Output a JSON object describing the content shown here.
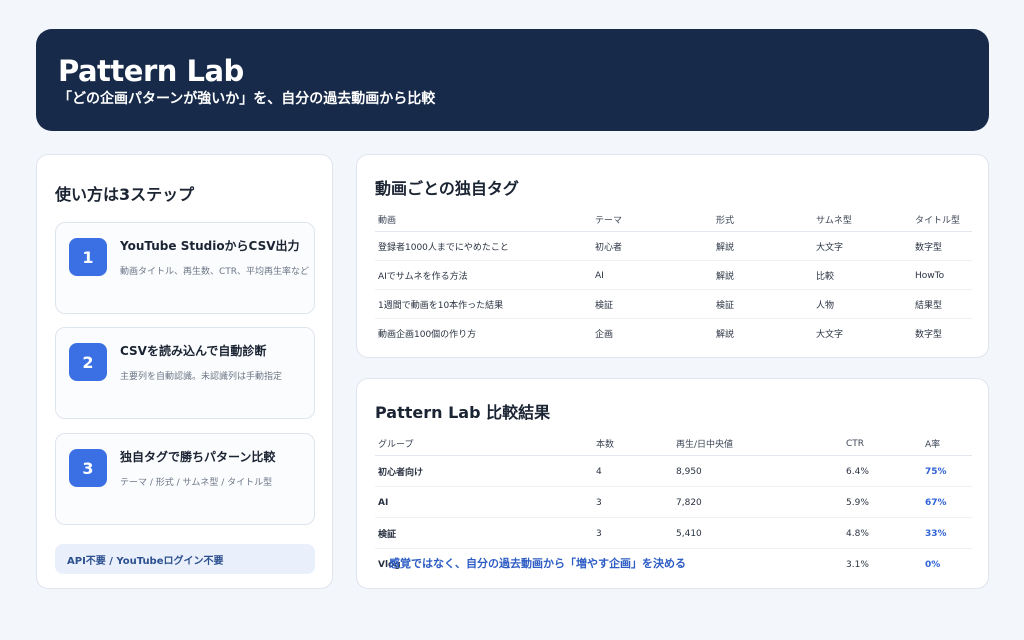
{
  "hero": {
    "title": "Pattern Lab",
    "subtitle": "「どの企画パターンが強いか」を、自分の過去動画から比較"
  },
  "howto": {
    "title": "使い方は3ステップ",
    "steps": [
      {
        "num": "1",
        "title": "YouTube StudioからCSV出力",
        "desc": "動画タイトル、再生数、CTR、平均再生率など"
      },
      {
        "num": "2",
        "title": "CSVを読み込んで自動診断",
        "desc": "主要列を自動認識。未認識列は手動指定"
      },
      {
        "num": "3",
        "title": "独自タグで勝ちパターン比較",
        "desc": "テーマ / 形式 / サムネ型 / タイトル型"
      }
    ],
    "note": "API不要 / YouTubeログイン不要"
  },
  "tags": {
    "title": "動画ごとの独自タグ",
    "headers": [
      "動画",
      "テーマ",
      "形式",
      "サムネ型",
      "タイトル型"
    ],
    "rows": [
      [
        "登録者1000人までにやめたこと",
        "初心者",
        "解説",
        "大文字",
        "数字型"
      ],
      [
        "AIでサムネを作る方法",
        "AI",
        "解説",
        "比較",
        "HowTo"
      ],
      [
        "1週間で動画を10本作った結果",
        "検証",
        "検証",
        "人物",
        "結果型"
      ],
      [
        "動画企画100個の作り方",
        "企画",
        "解説",
        "大文字",
        "数字型"
      ]
    ]
  },
  "results": {
    "title": "Pattern Lab 比較結果",
    "headers": [
      "グループ",
      "本数",
      "再生/日中央値",
      "CTR",
      "A率"
    ],
    "rows": [
      [
        "初心者向け",
        "4",
        "8,950",
        "6.4%",
        "75%"
      ],
      [
        "AI",
        "3",
        "7,820",
        "5.9%",
        "67%"
      ],
      [
        "検証",
        "3",
        "5,410",
        "4.8%",
        "33%"
      ],
      [
        "Vlog",
        "",
        "",
        "3.1%",
        "0%"
      ]
    ],
    "footer": "感覚ではなく、自分の過去動画から「増やす企画」を決める"
  }
}
